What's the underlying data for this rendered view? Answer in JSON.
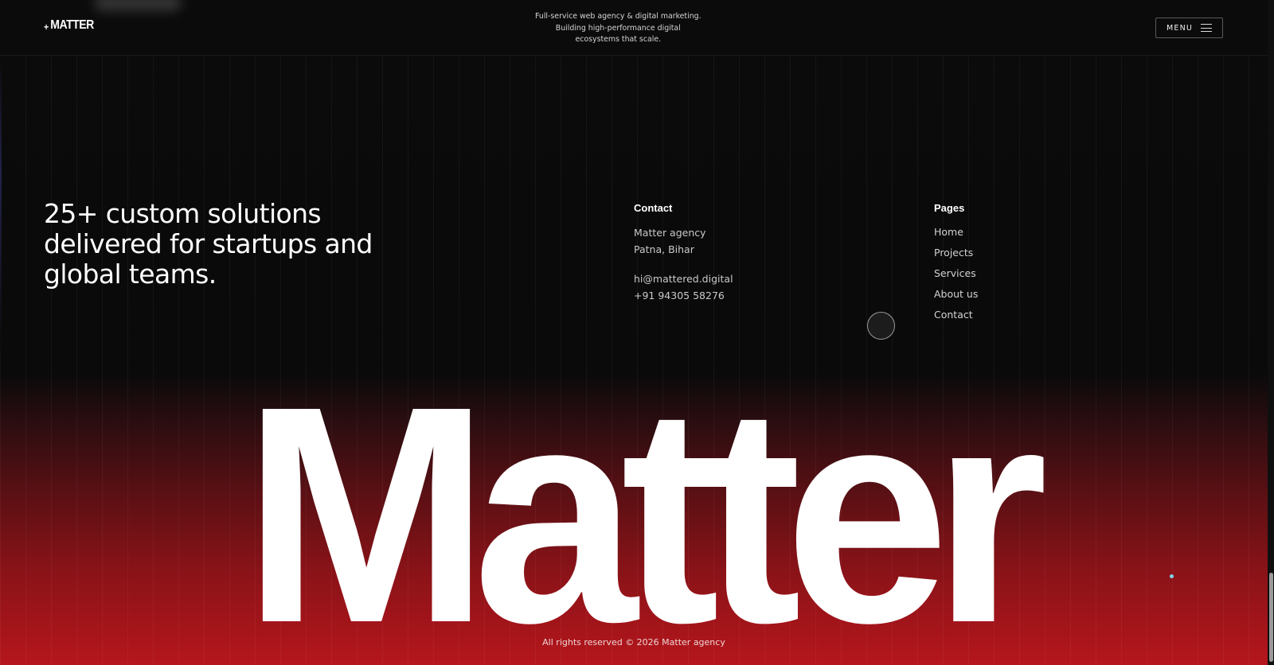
{
  "header": {
    "logo_plus": "+",
    "logo_text": "MATTER",
    "tagline": [
      "Full-service web agency & digital marketing.",
      "Building high-performance digital",
      "ecosystems that scale."
    ],
    "menu_label": "MENU"
  },
  "hero": {
    "headline": "25+ custom solutions delivered for startups and global teams."
  },
  "contact": {
    "title": "Contact",
    "name": "Matter agency",
    "location": "Patna, Bihar",
    "email": "hi@mattered.digital",
    "phone": "+91 94305 58276"
  },
  "pages": {
    "title": "Pages",
    "items": [
      "Home",
      "Projects",
      "Services",
      "About us",
      "Contact"
    ]
  },
  "wordmark": "Matter",
  "footer": {
    "copyright": "All rights reserved © 2026 Matter agency"
  },
  "colors": {
    "background": "#0b0b0b",
    "gradient_red": "#b5161c",
    "text": "#ffffff",
    "muted": "#c9c9c9"
  }
}
